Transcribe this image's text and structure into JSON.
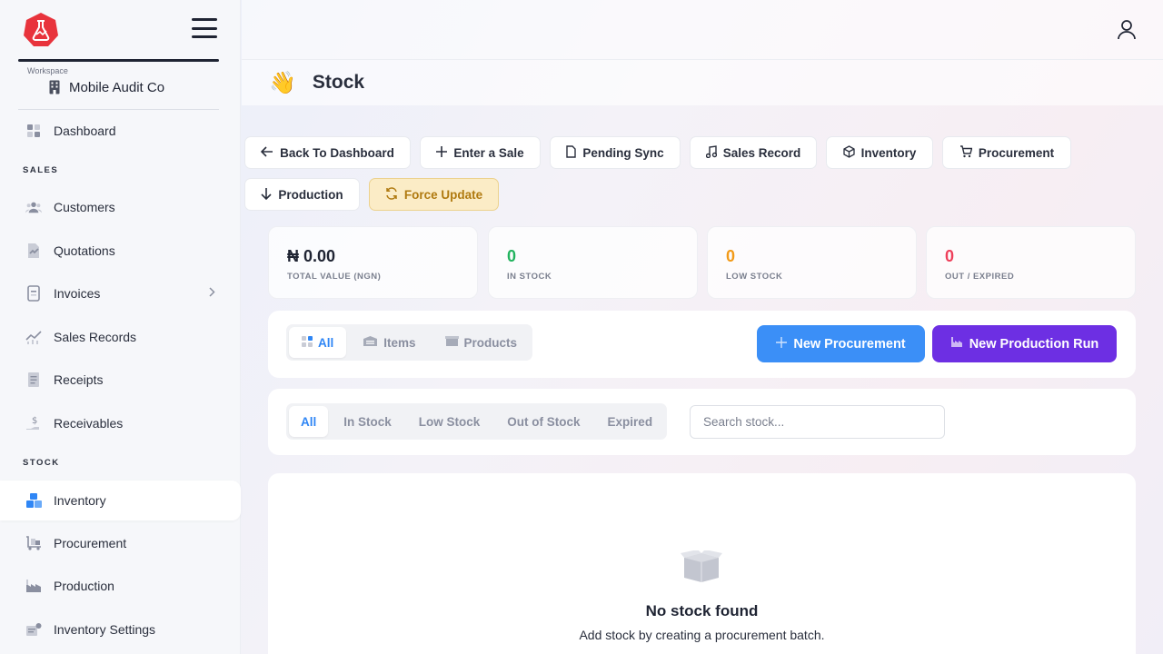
{
  "sidebar": {
    "workspace_label": "Workspace",
    "workspace_name": "Mobile Audit Co",
    "sections": {
      "sales": "SALES",
      "stock": "STOCK"
    },
    "items": [
      {
        "label": "Dashboard",
        "icon": "grid-icon"
      },
      {
        "label": "Customers",
        "icon": "users-icon"
      },
      {
        "label": "Quotations",
        "icon": "quote-doc-icon"
      },
      {
        "label": "Invoices",
        "icon": "invoice-icon"
      },
      {
        "label": "Sales Records",
        "icon": "chart-line-icon"
      },
      {
        "label": "Receipts",
        "icon": "receipt-icon"
      },
      {
        "label": "Receivables",
        "icon": "dollar-hand-icon"
      },
      {
        "label": "Inventory",
        "icon": "boxes-icon"
      },
      {
        "label": "Procurement",
        "icon": "cart-dolly-icon"
      },
      {
        "label": "Production",
        "icon": "factory-icon"
      },
      {
        "label": "Inventory Settings",
        "icon": "settings-box-icon"
      }
    ]
  },
  "header": {
    "title": "Stock",
    "emoji": "👋"
  },
  "actions": [
    {
      "label": "Back To Dashboard",
      "icon": "arrow-left-icon"
    },
    {
      "label": "Enter a Sale",
      "icon": "plus-icon"
    },
    {
      "label": "Pending Sync",
      "icon": "file-icon"
    },
    {
      "label": "Sales Record",
      "icon": "music-note-icon"
    },
    {
      "label": "Inventory",
      "icon": "cube-icon"
    },
    {
      "label": "Procurement",
      "icon": "cart-icon"
    },
    {
      "label": "Production",
      "icon": "arrow-down-icon"
    },
    {
      "label": "Force Update",
      "icon": "refresh-icon"
    }
  ],
  "stats": [
    {
      "value": "₦ 0.00",
      "label": "TOTAL VALUE (NGN)",
      "color": "#1f2433"
    },
    {
      "value": "0",
      "label": "IN STOCK",
      "color": "#22b35e"
    },
    {
      "value": "0",
      "label": "LOW STOCK",
      "color": "#f29a18"
    },
    {
      "value": "0",
      "label": "OUT / EXPIRED",
      "color": "#ee3f5a"
    }
  ],
  "type_filter": {
    "options": [
      "All",
      "Items",
      "Products"
    ],
    "selected": "All"
  },
  "buttons": {
    "new_procurement": "New Procurement",
    "new_production_run": "New Production Run"
  },
  "status_filter": {
    "options": [
      "All",
      "In Stock",
      "Low Stock",
      "Out of Stock",
      "Expired"
    ],
    "selected": "All"
  },
  "search": {
    "placeholder": "Search stock..."
  },
  "empty_state": {
    "title": "No stock found",
    "subtitle": "Add stock by creating a procurement batch."
  },
  "colors": {
    "accent_blue": "#2f86f5",
    "accent_purple": "#6d2fe3",
    "brand_red": "#e8333c"
  }
}
